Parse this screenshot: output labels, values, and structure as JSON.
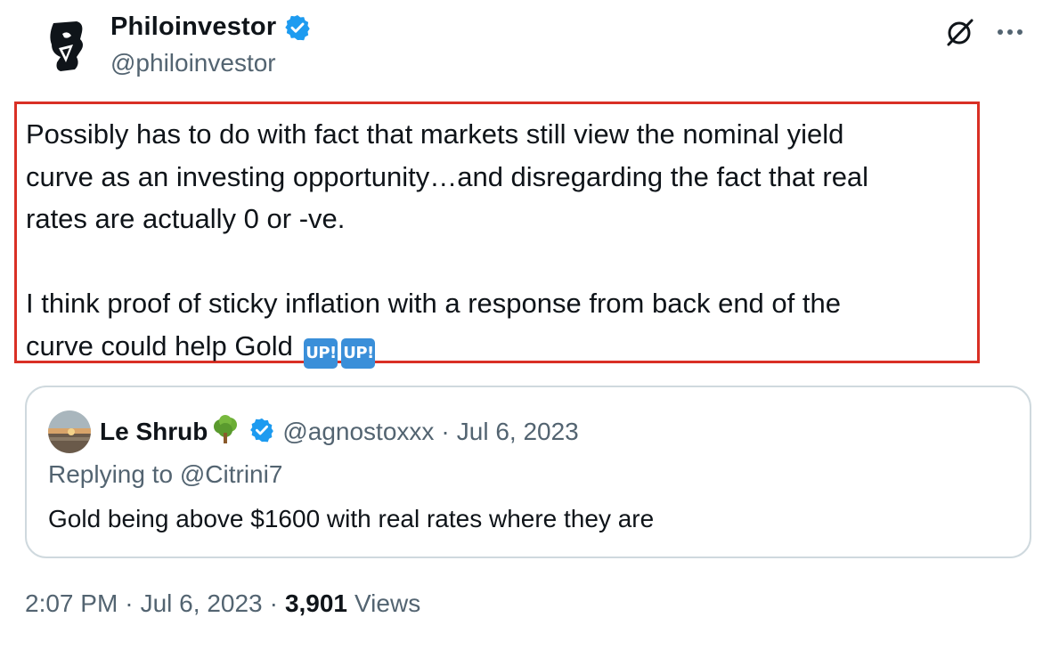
{
  "author": {
    "display_name": "Philoinvestor",
    "handle": "@philoinvestor",
    "avatar_icon": "stylized-head-logo-icon",
    "verified": true
  },
  "actions": {
    "grok_icon": "slashed-circle-icon",
    "more_icon": "more-options-icon"
  },
  "tweet": {
    "paragraph_1_line_1": "Possibly has to do with fact that markets still view the nominal yield",
    "paragraph_1_line_2": "curve as an investing opportunity…and disregarding the fact that real",
    "paragraph_1_line_3": "rates are actually 0 or -ve.",
    "paragraph_2_line_1": "I think proof of sticky inflation with a response from back end of the",
    "paragraph_2_line_2": "curve could help Gold ",
    "emoji_1": "UP!",
    "emoji_2": "UP!",
    "highlight_color": "#d93025"
  },
  "quoted_tweet": {
    "display_name": "Le Shrub",
    "name_emoji_icon": "tree-icon",
    "handle": "@agnostoxxx",
    "separator": "·",
    "date": "Jul 6, 2023",
    "replying_to": "Replying to @Citrini7",
    "text": "Gold being above $1600 with real rates where they are",
    "verified": true
  },
  "meta": {
    "time": "2:07 PM",
    "separator": "·",
    "date": "Jul 6, 2023",
    "views_count": "3,901",
    "views_label": "Views"
  },
  "colors": {
    "text_primary": "#0f1419",
    "text_secondary": "#536471",
    "verified_blue": "#1d9bf0",
    "border": "#cfd9de"
  }
}
